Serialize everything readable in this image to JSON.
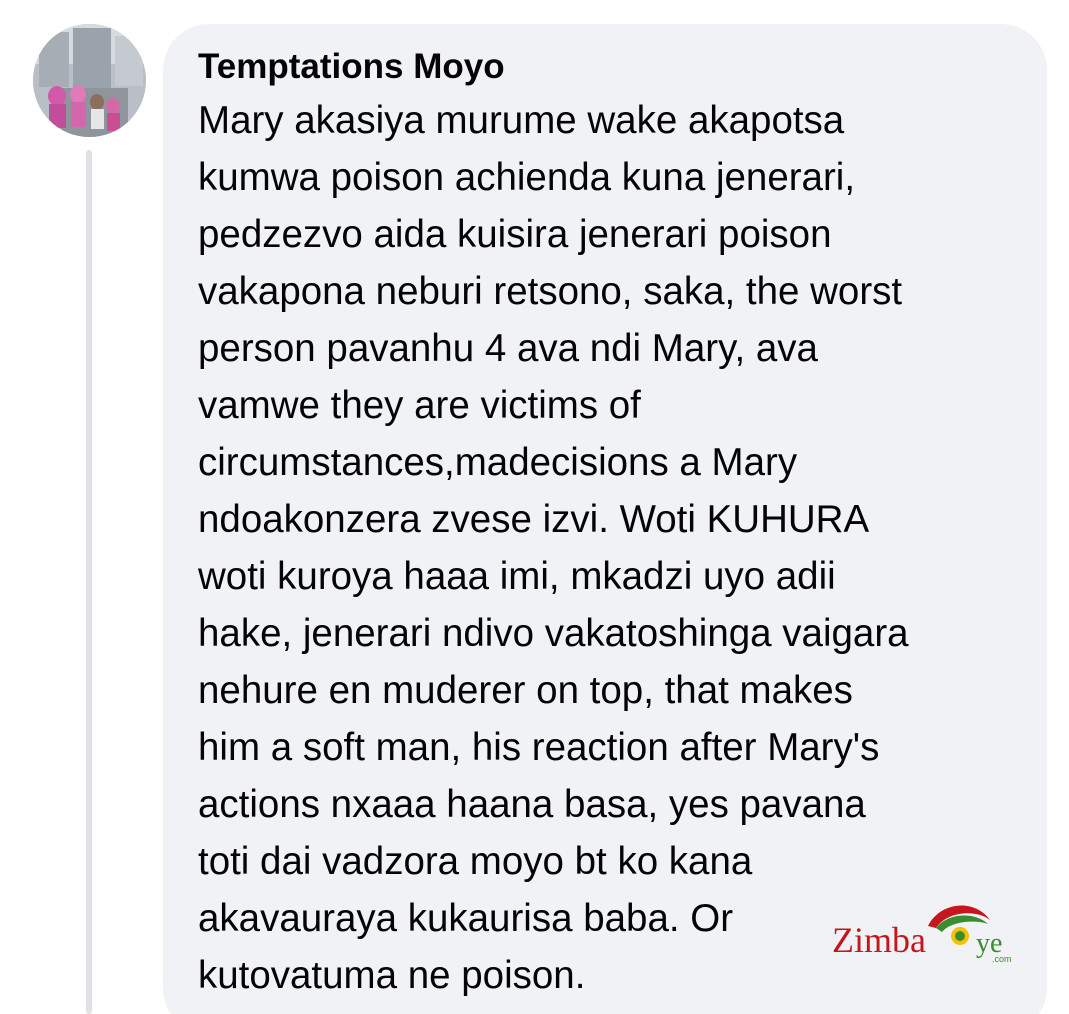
{
  "comment": {
    "author": "Temptations Moyo",
    "text": "Mary akasiya murume wake akapotsa\nkumwa poison achienda kuna jenerari,\npedzezvo aida kuisira jenerari poison\nvakapona neburi retsono, saka, the worst\nperson pavanhu 4 ava ndi Mary, ava\nvamwe they are victims of\ncircumstances,madecisions a Mary\nndoakonzera zvese izvi. Woti KUHURA\nwoti kuroya haaa imi, mkadzi uyo adii\nhake, jenerari ndivo vakatoshinga vaigara\nnehure en muderer on top, that makes\nhim a soft man, his reaction after Mary's\nactions nxaaa haana basa, yes pavana\ntoti dai vadzora moyo bt ko kana\nakavauraya kukaurisa baba. Or\nkutovatuma ne poison.",
    "colors": {
      "bubble": "#f0f2f5",
      "text": "#050505",
      "thread_line": "#dfe1e4"
    }
  },
  "watermark": {
    "text_left": "Zimba",
    "text_right": "ye",
    "suffix": ".com",
    "colors": {
      "red": "#c4161c",
      "green": "#3a8d2f",
      "yellow": "#f2c200"
    }
  }
}
